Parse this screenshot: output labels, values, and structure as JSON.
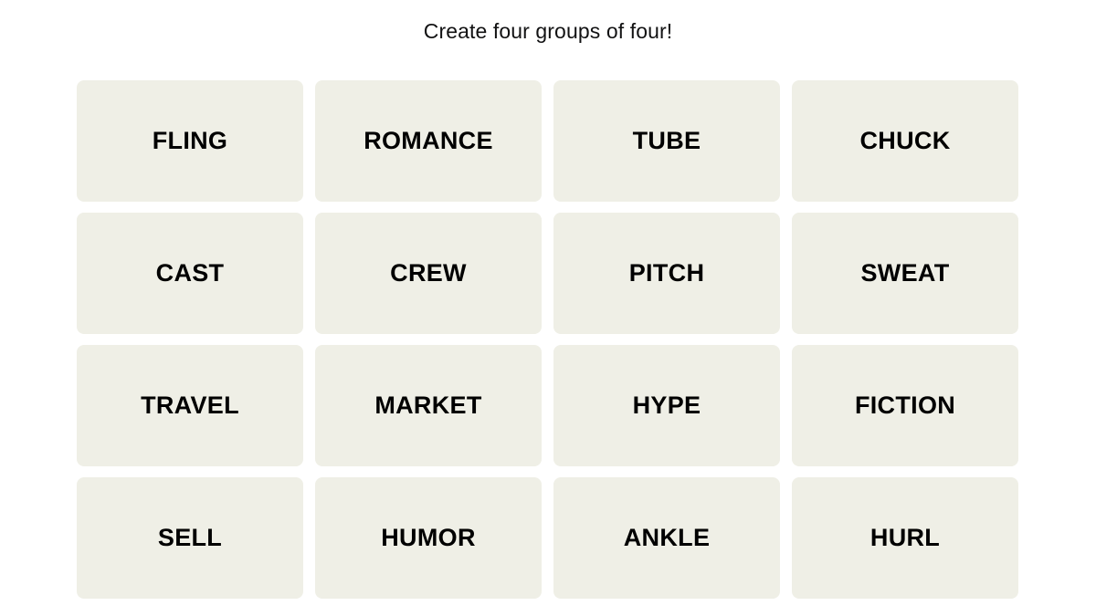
{
  "page": {
    "background_color": "#ffffff"
  },
  "header": {
    "instruction": "Create four groups of four!"
  },
  "board": {
    "rows": 4,
    "columns": 4,
    "tile_color": "#efefe6",
    "tile_text_color": "#000000",
    "tiles": [
      {
        "label": "FLING"
      },
      {
        "label": "ROMANCE"
      },
      {
        "label": "TUBE"
      },
      {
        "label": "CHUCK"
      },
      {
        "label": "CAST"
      },
      {
        "label": "CREW"
      },
      {
        "label": "PITCH"
      },
      {
        "label": "SWEAT"
      },
      {
        "label": "TRAVEL"
      },
      {
        "label": "MARKET"
      },
      {
        "label": "HYPE"
      },
      {
        "label": "FICTION"
      },
      {
        "label": "SELL"
      },
      {
        "label": "HUMOR"
      },
      {
        "label": "ANKLE"
      },
      {
        "label": "HURL"
      }
    ]
  }
}
